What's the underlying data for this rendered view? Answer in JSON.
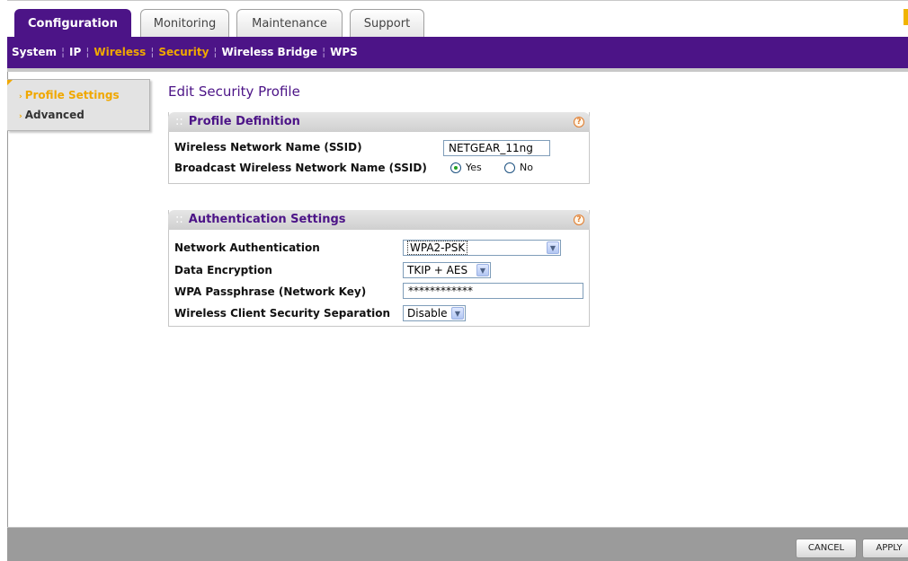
{
  "tabs": [
    {
      "label": "Configuration",
      "active": true
    },
    {
      "label": "Monitoring"
    },
    {
      "label": "Maintenance"
    },
    {
      "label": "Support"
    }
  ],
  "subnav": {
    "items": [
      {
        "label": "System"
      },
      {
        "label": "IP"
      },
      {
        "label": "Wireless",
        "active": true
      },
      {
        "label": "Security",
        "active": true
      },
      {
        "label": "Wireless Bridge"
      },
      {
        "label": "WPS"
      }
    ]
  },
  "leftmenu": {
    "items": [
      {
        "label": "Profile Settings",
        "active": true
      },
      {
        "label": "Advanced"
      }
    ]
  },
  "page": {
    "title": "Edit Security Profile"
  },
  "profile_definition": {
    "heading": "Profile Definition",
    "ssid_label": "Wireless Network Name (SSID)",
    "ssid_value": "NETGEAR_11ng",
    "broadcast_label": "Broadcast Wireless Network Name (SSID)",
    "broadcast_yes": "Yes",
    "broadcast_no": "No",
    "broadcast_selected": "Yes"
  },
  "authentication": {
    "heading": "Authentication Settings",
    "network_auth_label": "Network Authentication",
    "network_auth_value": "WPA2-PSK",
    "encryption_label": "Data Encryption",
    "encryption_value": "TKIP + AES",
    "passphrase_label": "WPA Passphrase (Network Key)",
    "passphrase_value": "************",
    "separation_label": "Wireless Client Security Separation",
    "separation_value": "Disable"
  },
  "buttons": {
    "cancel": "CANCEL",
    "apply": "APPLY"
  },
  "colors": {
    "brand_purple": "#4c1487",
    "accent_orange": "#f0a800"
  }
}
